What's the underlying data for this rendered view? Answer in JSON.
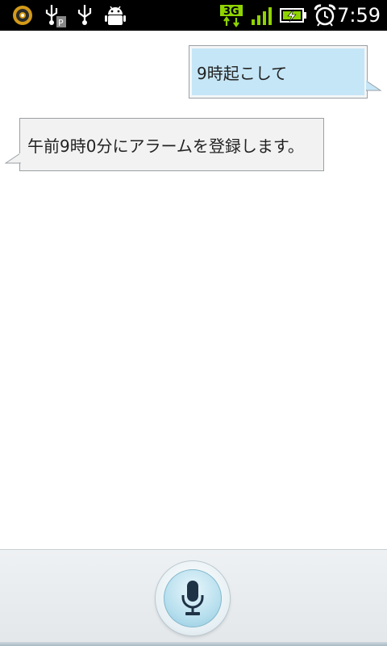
{
  "status_bar": {
    "time": "7:59",
    "network_type": "3G",
    "icons": [
      "rocket-launcher-icon",
      "usb-debugging-icon",
      "usb-icon",
      "android-debug-icon",
      "network-3g-icon",
      "signal-strength-icon",
      "battery-charging-icon",
      "alarm-clock-icon"
    ]
  },
  "conversation": {
    "user_message": "9時起こして",
    "assistant_message": "午前9時0分にアラームを登録します。"
  },
  "bottom_bar": {
    "icon": "microphone-icon"
  },
  "colors": {
    "status_bar_bg": "#000000",
    "user_bubble_bg": "#c5e6f7",
    "assistant_bubble_bg": "#f2f2f2",
    "signal_green": "#8fd400"
  }
}
